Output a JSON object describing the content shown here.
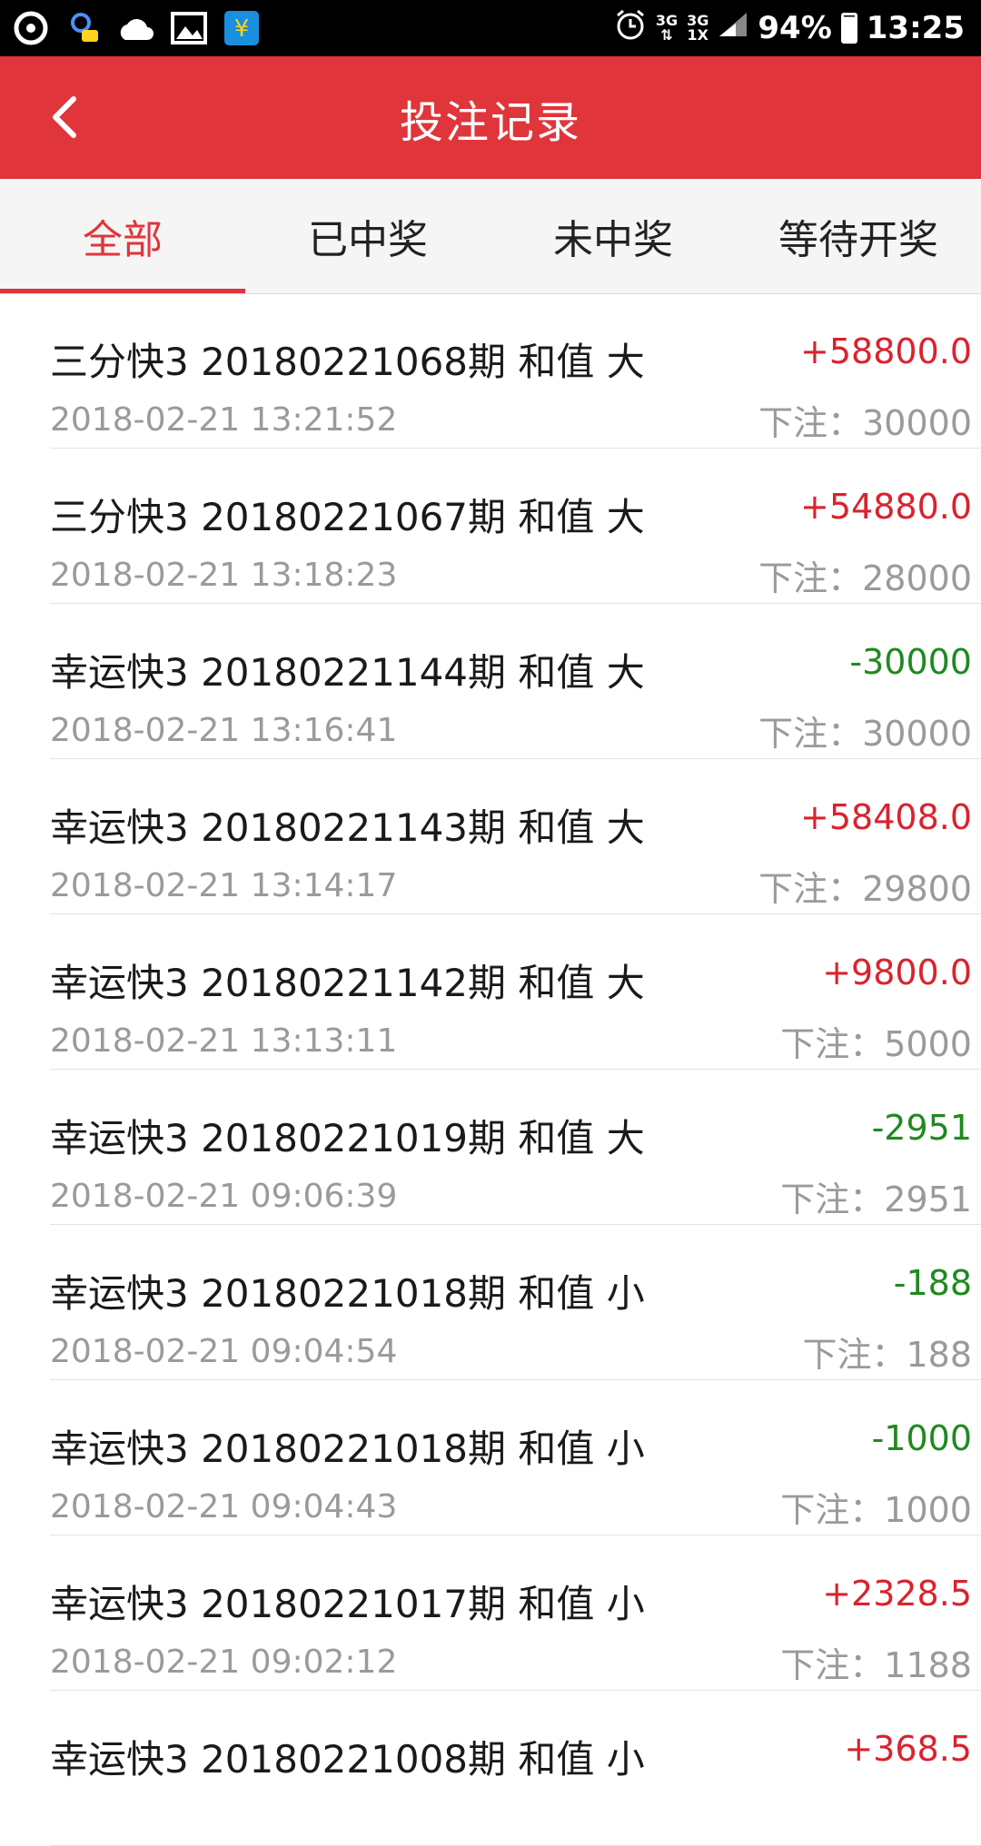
{
  "status_bar": {
    "network_top": "3G",
    "network_bottom": "1X",
    "battery": "94%",
    "time": "13:25"
  },
  "header": {
    "title": "投注记录"
  },
  "tabs": [
    {
      "label": "全部",
      "active": true
    },
    {
      "label": "已中奖",
      "active": false
    },
    {
      "label": "未中奖",
      "active": false
    },
    {
      "label": "等待开奖",
      "active": false
    }
  ],
  "records": [
    {
      "title": "三分快3 20180221068期 和值 大",
      "time": "2018-02-21 13:21:52",
      "amount": "+58800.0",
      "bet": "下注：30000",
      "type": "win"
    },
    {
      "title": "三分快3 20180221067期 和值 大",
      "time": "2018-02-21 13:18:23",
      "amount": "+54880.0",
      "bet": "下注：28000",
      "type": "win"
    },
    {
      "title": "幸运快3 20180221144期 和值 大",
      "time": "2018-02-21 13:16:41",
      "amount": "-30000",
      "bet": "下注：30000",
      "type": "lose"
    },
    {
      "title": "幸运快3 20180221143期 和值 大",
      "time": "2018-02-21 13:14:17",
      "amount": "+58408.0",
      "bet": "下注：29800",
      "type": "win"
    },
    {
      "title": "幸运快3 20180221142期 和值 大",
      "time": "2018-02-21 13:13:11",
      "amount": "+9800.0",
      "bet": "下注：5000",
      "type": "win"
    },
    {
      "title": "幸运快3 20180221019期 和值 大",
      "time": "2018-02-21 09:06:39",
      "amount": "-2951",
      "bet": "下注：2951",
      "type": "lose"
    },
    {
      "title": "幸运快3 20180221018期 和值 小",
      "time": "2018-02-21 09:04:54",
      "amount": "-188",
      "bet": "下注：188",
      "type": "lose"
    },
    {
      "title": "幸运快3 20180221018期 和值 小",
      "time": "2018-02-21 09:04:43",
      "amount": "-1000",
      "bet": "下注：1000",
      "type": "lose"
    },
    {
      "title": "幸运快3 20180221017期 和值 小",
      "time": "2018-02-21 09:02:12",
      "amount": "+2328.5",
      "bet": "下注：1188",
      "type": "win"
    },
    {
      "title": "幸运快3 20180221008期 和值 小",
      "time": "",
      "amount": "+368.5",
      "bet": "",
      "type": "win"
    }
  ]
}
